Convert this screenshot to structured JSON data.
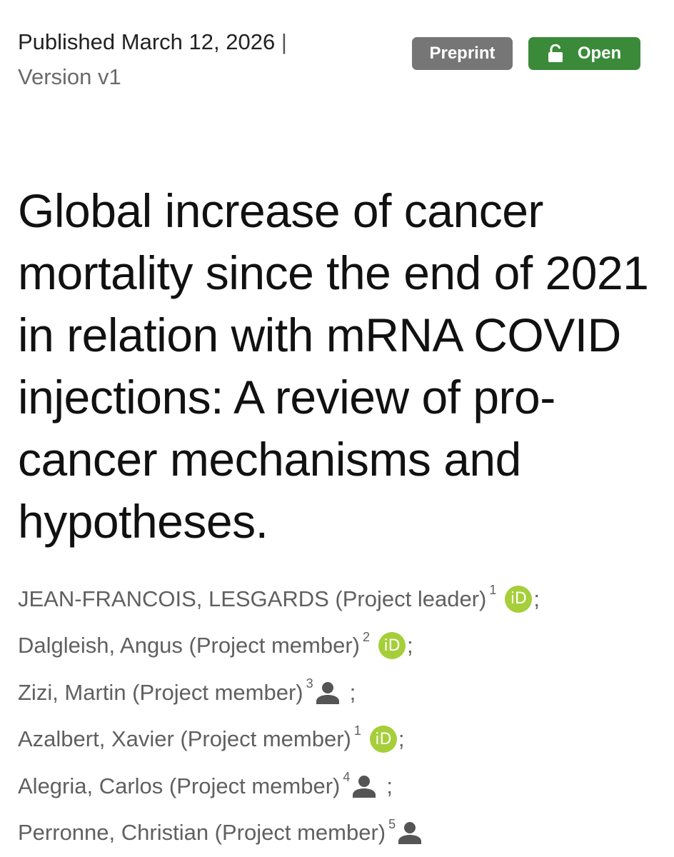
{
  "header": {
    "published": "Published March 12, 2026",
    "separator": "|",
    "version": "Version v1"
  },
  "badges": {
    "preprint": "Preprint",
    "open": "Open",
    "open_icon": "unlock-icon",
    "colors": {
      "preprint": "#767676",
      "open": "#3a8a3a"
    }
  },
  "title": "Global increase of cancer mortality since the end of 2021 in relation with mRNA COVID injections: A review of pro-cancer mechanisms and hypotheses.",
  "authors": [
    {
      "name": "JEAN-FRANCOIS, LESGARDS (Project leader)",
      "affiliation": "1",
      "icon": "orcid-icon",
      "orcid_label": "iD",
      "separator": ";"
    },
    {
      "name": "Dalgleish, Angus (Project member)",
      "affiliation": "2",
      "icon": "orcid-icon",
      "orcid_label": "iD",
      "separator": ";"
    },
    {
      "name": "Zizi, Martin (Project member)",
      "affiliation": "3",
      "icon": "person-icon",
      "separator": ";"
    },
    {
      "name": "Azalbert, Xavier (Project member)",
      "affiliation": "1",
      "icon": "orcid-icon",
      "orcid_label": "iD",
      "separator": ";"
    },
    {
      "name": "Alegria, Carlos (Project member)",
      "affiliation": "4",
      "icon": "person-icon",
      "separator": ";"
    },
    {
      "name": "Perronne, Christian (Project member)",
      "affiliation": "5",
      "icon": "person-icon",
      "separator": ""
    }
  ],
  "colors": {
    "orcid": "#a6ce39",
    "person": "#555555"
  }
}
